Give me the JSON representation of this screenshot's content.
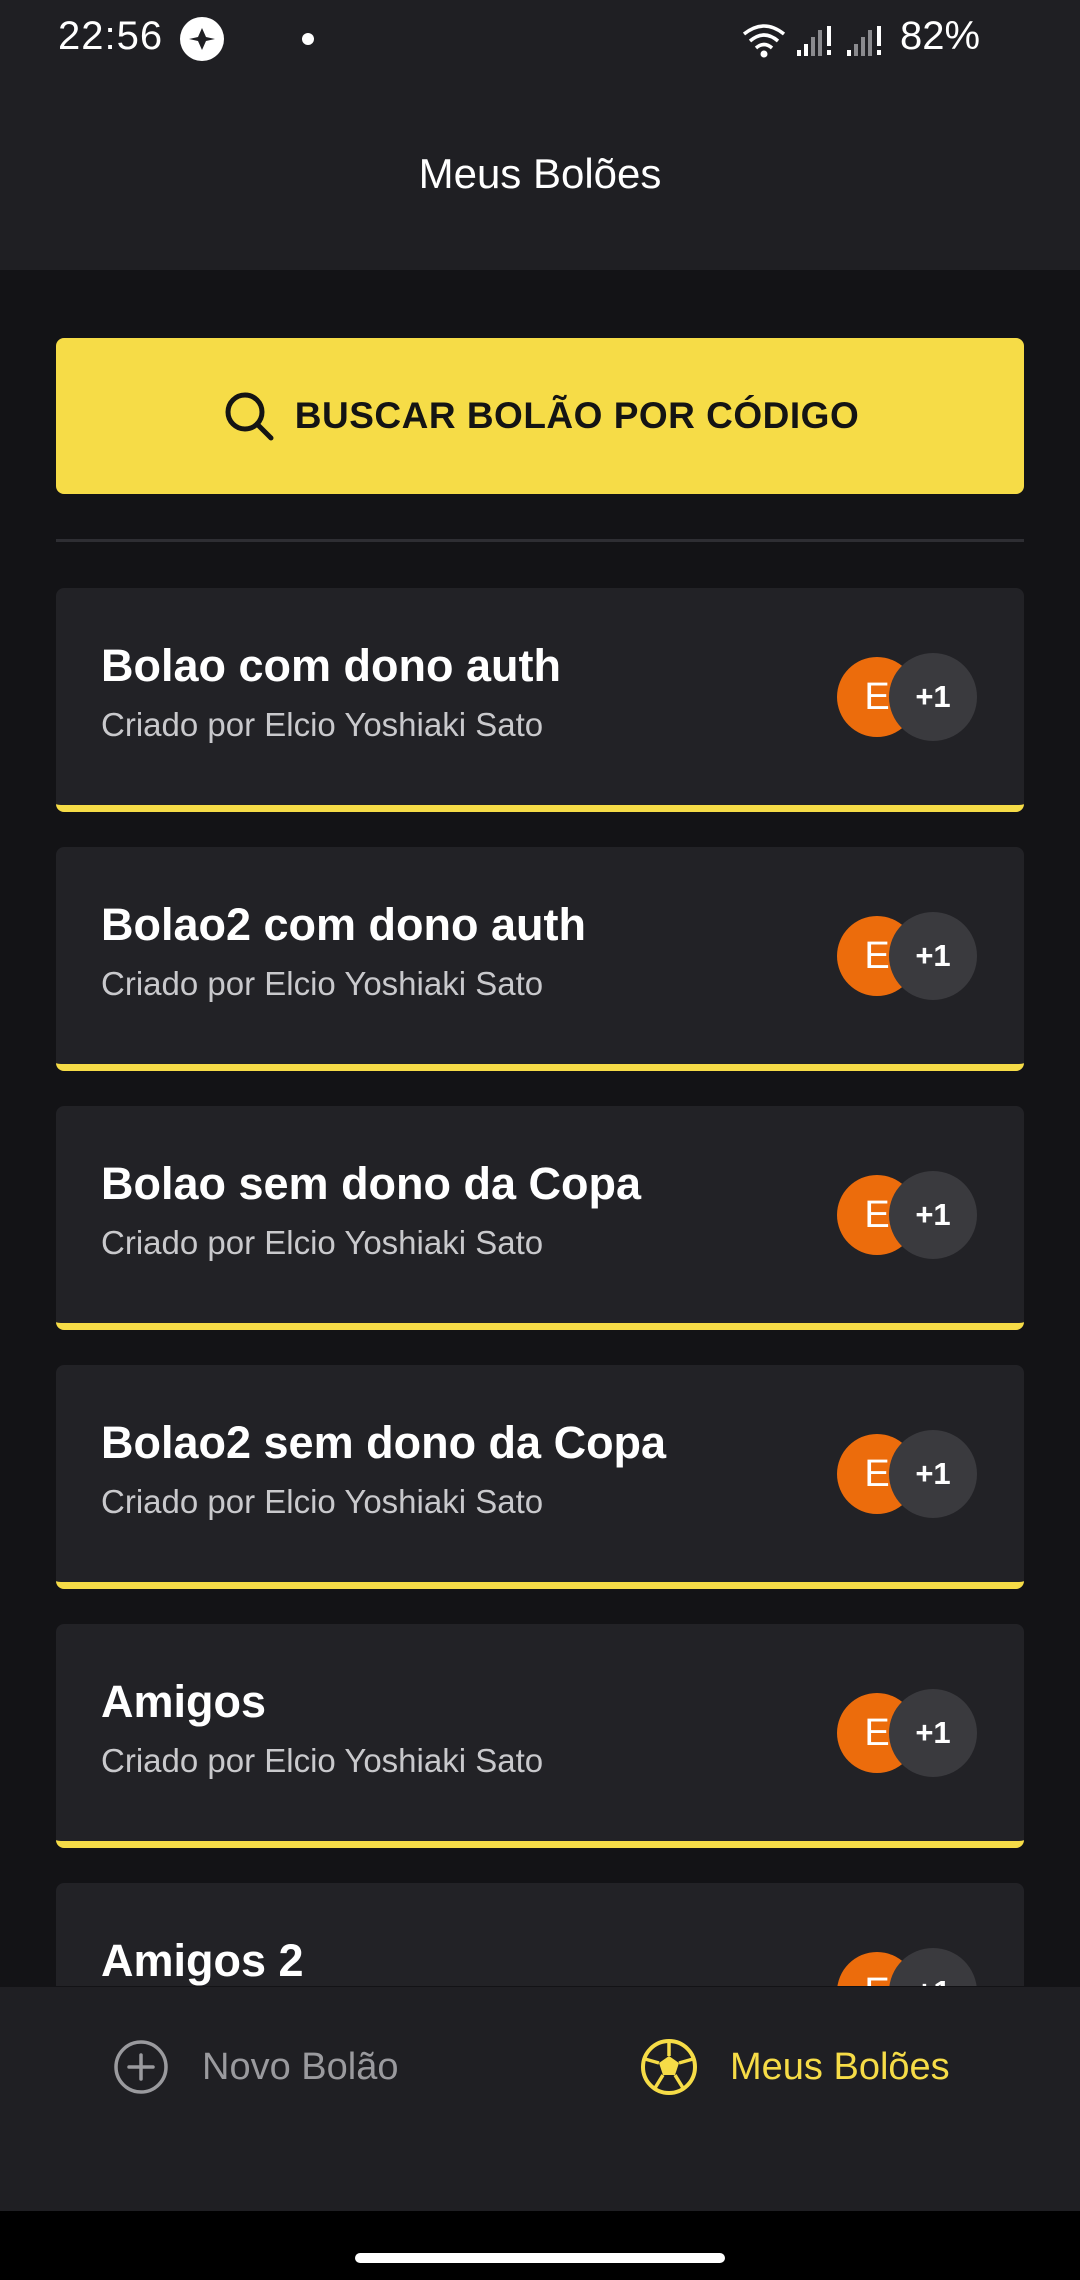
{
  "status_bar": {
    "time": "22:56",
    "battery": "82%"
  },
  "app_bar": {
    "title": "Meus Bolões"
  },
  "search": {
    "label": "BUSCAR BOLÃO POR CÓDIGO",
    "icon": "search-icon"
  },
  "pools": [
    {
      "name": "Bolao com dono auth",
      "creator": "Criado por Elcio Yoshiaki Sato",
      "owner_initial": "E",
      "extra_members": "+1"
    },
    {
      "name": "Bolao2 com dono auth",
      "creator": "Criado por Elcio Yoshiaki Sato",
      "owner_initial": "E",
      "extra_members": "+1"
    },
    {
      "name": "Bolao sem dono da Copa",
      "creator": "Criado por Elcio Yoshiaki Sato",
      "owner_initial": "E",
      "extra_members": "+1"
    },
    {
      "name": "Bolao2 sem dono da Copa",
      "creator": "Criado por Elcio Yoshiaki Sato",
      "owner_initial": "E",
      "extra_members": "+1"
    },
    {
      "name": "Amigos",
      "creator": "Criado por Elcio Yoshiaki Sato",
      "owner_initial": "E",
      "extra_members": "+1"
    },
    {
      "name": "Amigos 2",
      "creator": "",
      "owner_initial": "E",
      "extra_members": "+1"
    }
  ],
  "bottom_nav": {
    "new_label": "Novo Bolão",
    "mine_label": "Meus Bolões",
    "active": "mine"
  },
  "colors": {
    "accent": "#f6dc47",
    "avatar_owner": "#ec6c0c",
    "card_bg": "#222226",
    "page_bg": "#131316"
  }
}
